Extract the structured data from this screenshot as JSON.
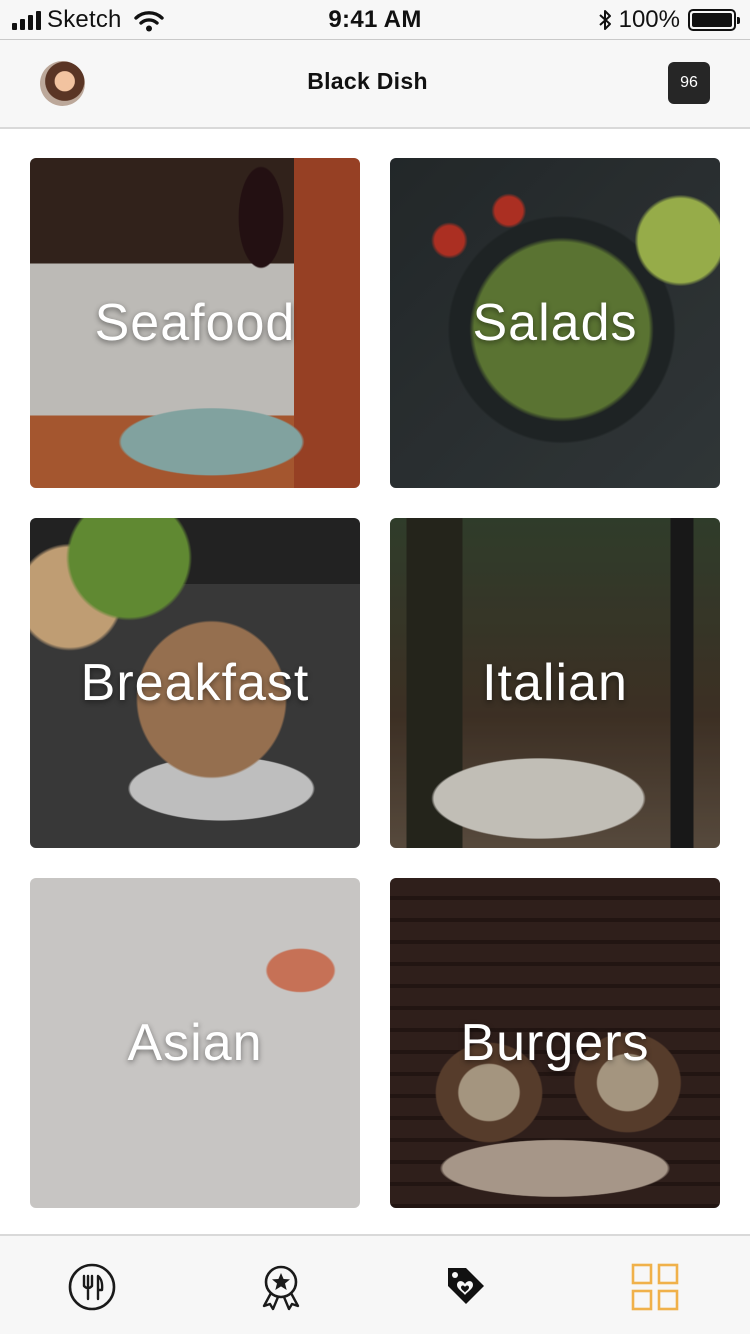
{
  "status_bar": {
    "carrier": "Sketch",
    "time": "9:41 AM",
    "battery_percent": "100%"
  },
  "header": {
    "title": "Black Dish",
    "count_badge": "96"
  },
  "categories": [
    {
      "label": "Seafood"
    },
    {
      "label": "Salads"
    },
    {
      "label": "Breakfast"
    },
    {
      "label": "Italian"
    },
    {
      "label": "Asian"
    },
    {
      "label": "Burgers"
    }
  ],
  "tab_bar": {
    "active_tab": "categories",
    "active_color": "#f0b14a",
    "icons": [
      "fork-knife-icon",
      "award-ribbon-icon",
      "tag-heart-icon",
      "grid-icon"
    ]
  }
}
